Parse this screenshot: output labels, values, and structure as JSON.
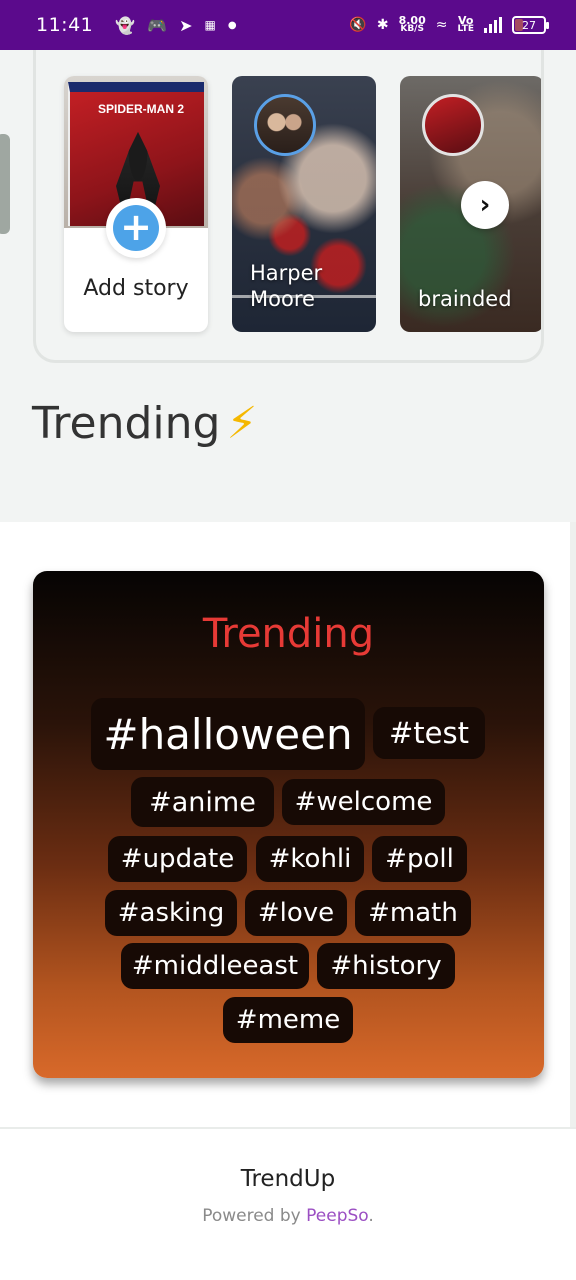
{
  "status_bar": {
    "time": "11:41",
    "net_speed_value": "8.00",
    "net_speed_unit": "KB/S",
    "volte_top": "Vo",
    "volte_bottom": "LTE",
    "battery": "27"
  },
  "stories": {
    "add_story_label": "Add story",
    "add_thumb_title": "SPIDER-MAN 2",
    "items": [
      {
        "name": "Harper Moore"
      },
      {
        "name": "brainded"
      }
    ]
  },
  "trending_section": {
    "heading": "Trending",
    "bolt": "⚡"
  },
  "trending_card": {
    "title": "Trending",
    "tags": [
      "#halloween",
      "#test",
      "#anime",
      "#welcome",
      "#update",
      "#kohli",
      "#poll",
      "#asking",
      "#love",
      "#math",
      "#middleeast",
      "#history",
      "#meme"
    ]
  },
  "footer": {
    "title": "TrendUp",
    "powered_prefix": "Powered by ",
    "powered_link": "PeepSo",
    "powered_suffix": "."
  },
  "colors": {
    "status_bar": "#5b0a8c",
    "trend_title": "#e73a36",
    "add_button": "#4da3e8",
    "link": "#9b4fc3"
  }
}
